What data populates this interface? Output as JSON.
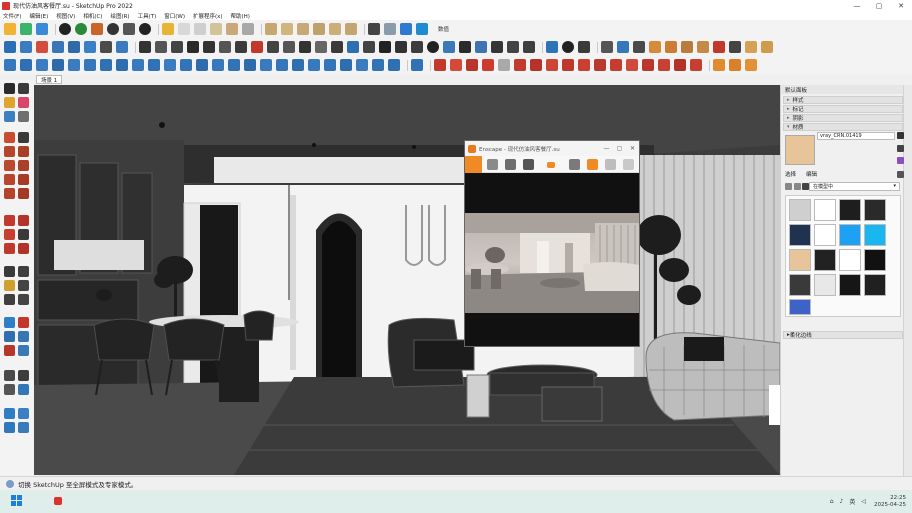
{
  "window": {
    "title": "现代仿油风客餐厅.su - SketchUp Pro 2022",
    "minimize": "—",
    "maximize": "▢",
    "close": "✕"
  },
  "menu": [
    "文件(F)",
    "编辑(E)",
    "视图(V)",
    "相机(C)",
    "绘图(R)",
    "工具(T)",
    "窗口(W)",
    "扩展程序(x)",
    "帮助(H)"
  ],
  "toolbar": {
    "value_label": "数值"
  },
  "scene": {
    "tab_label": "场景 1"
  },
  "enscape": {
    "title": "Enscape - 现代仿油风客餐厅.su",
    "minimize": "—",
    "maximize": "▢",
    "close": "✕"
  },
  "tray": {
    "title": "默认面板",
    "sections": [
      "样式",
      "标记",
      "阴影",
      "材质"
    ],
    "material_name": "vray_CRN.01419",
    "tab_select": "选择",
    "tab_edit": "编辑",
    "combo": "在模型中",
    "footer_section": "柔化边线",
    "swatch_colors": [
      "#cfcfcf",
      "#ffffff",
      "#1e1e1e",
      "#2a2a2a",
      "#1f3350",
      "#ffffff",
      "#1ea1f2",
      "#19b6f0",
      "#e8c49b",
      "#222222",
      "#ffffff",
      "#111111",
      "#3a3a3a",
      "#e8e8e8",
      "#161616",
      "#202020",
      "#3e62c8"
    ]
  },
  "status": {
    "message": "切换 SketchUp 至全屏模式及专家模式。"
  },
  "taskbar": {
    "lang": "英",
    "time": "22:25",
    "date": "2025-04-25"
  },
  "colors": {
    "accent": "#f08a24",
    "sketchup_red": "#d9342b",
    "windows_blue": "#1f7fd8"
  }
}
